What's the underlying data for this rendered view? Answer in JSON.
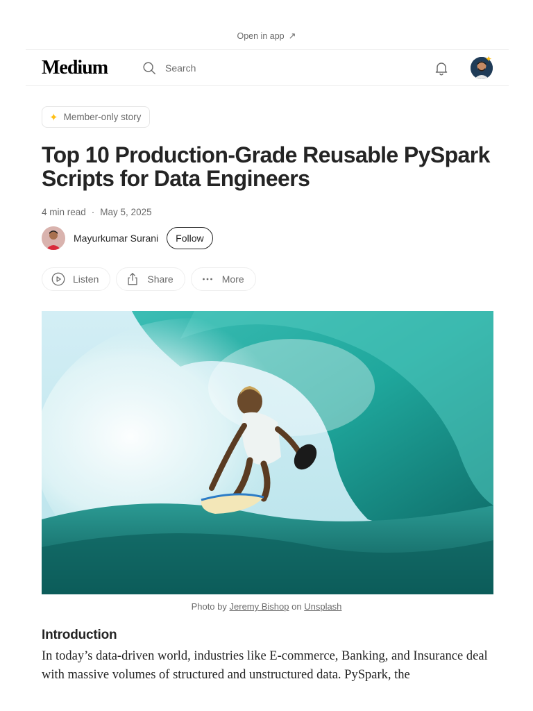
{
  "banner": {
    "open_in_app": "Open in app"
  },
  "header": {
    "logo": "Medium",
    "search": {
      "placeholder": "Search"
    }
  },
  "article": {
    "badge": "Member-only story",
    "title": "Top 10 Production-Grade Reusable PySpark Scripts for Data Engineers",
    "read_time": "4 min read",
    "dot": "·",
    "date": "May 5, 2025",
    "author": {
      "name": "Mayurkumar Surani",
      "follow_label": "Follow"
    },
    "actions": {
      "listen": "Listen",
      "share": "Share",
      "more": "More"
    },
    "image_caption": {
      "prefix": "Photo by",
      "photographer": "Jeremy Bishop",
      "on": "on",
      "source": "Unsplash"
    },
    "intro_heading": "Introduction",
    "intro_text": "In today’s data-driven world, industries like E-commerce, Banking, and Insurance deal with massive volumes of structured and unstructured data. PySpark, the"
  },
  "icons": {
    "open_app": "arrow-up-right-icon",
    "search": "search-icon",
    "notifications": "bell-icon",
    "member": "sparkle-star-icon",
    "listen": "play-circle-icon",
    "share": "share-icon",
    "more": "more-dots-icon"
  },
  "colors": {
    "accent_star": "#ffc017",
    "text": "#242424",
    "muted": "#6b6b6b"
  }
}
